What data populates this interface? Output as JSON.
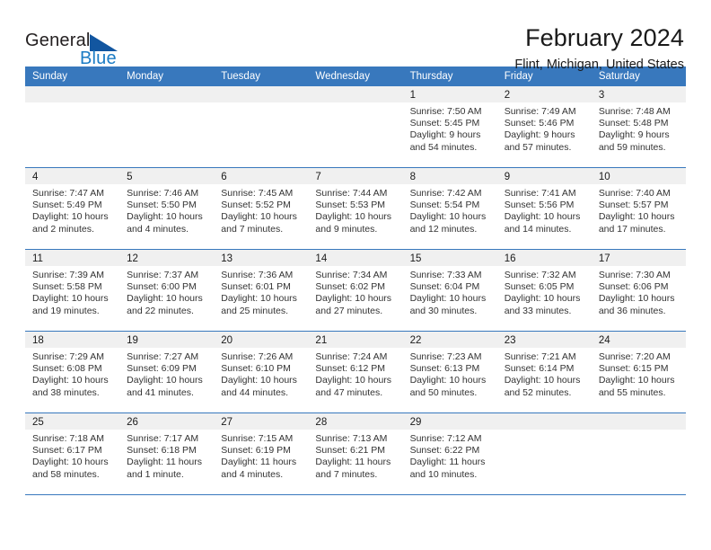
{
  "brand": {
    "word_one": "General",
    "word_two": "Blue",
    "logo_icon": "triangle-logo-icon"
  },
  "header": {
    "title": "February 2024",
    "location": "Flint, Michigan, United States"
  },
  "calendar": {
    "weekday_headers": [
      "Sunday",
      "Monday",
      "Tuesday",
      "Wednesday",
      "Thursday",
      "Friday",
      "Saturday"
    ],
    "accent_color": "#3878bd",
    "daynum_band_color": "#f0f0f0",
    "weeks": [
      [
        {
          "day": "",
          "sunrise": "",
          "sunset": "",
          "daylight": "",
          "empty": true
        },
        {
          "day": "",
          "sunrise": "",
          "sunset": "",
          "daylight": "",
          "empty": true
        },
        {
          "day": "",
          "sunrise": "",
          "sunset": "",
          "daylight": "",
          "empty": true
        },
        {
          "day": "",
          "sunrise": "",
          "sunset": "",
          "daylight": "",
          "empty": true
        },
        {
          "day": "1",
          "sunrise": "Sunrise: 7:50 AM",
          "sunset": "Sunset: 5:45 PM",
          "daylight": "Daylight: 9 hours and 54 minutes."
        },
        {
          "day": "2",
          "sunrise": "Sunrise: 7:49 AM",
          "sunset": "Sunset: 5:46 PM",
          "daylight": "Daylight: 9 hours and 57 minutes."
        },
        {
          "day": "3",
          "sunrise": "Sunrise: 7:48 AM",
          "sunset": "Sunset: 5:48 PM",
          "daylight": "Daylight: 9 hours and 59 minutes."
        }
      ],
      [
        {
          "day": "4",
          "sunrise": "Sunrise: 7:47 AM",
          "sunset": "Sunset: 5:49 PM",
          "daylight": "Daylight: 10 hours and 2 minutes."
        },
        {
          "day": "5",
          "sunrise": "Sunrise: 7:46 AM",
          "sunset": "Sunset: 5:50 PM",
          "daylight": "Daylight: 10 hours and 4 minutes."
        },
        {
          "day": "6",
          "sunrise": "Sunrise: 7:45 AM",
          "sunset": "Sunset: 5:52 PM",
          "daylight": "Daylight: 10 hours and 7 minutes."
        },
        {
          "day": "7",
          "sunrise": "Sunrise: 7:44 AM",
          "sunset": "Sunset: 5:53 PM",
          "daylight": "Daylight: 10 hours and 9 minutes."
        },
        {
          "day": "8",
          "sunrise": "Sunrise: 7:42 AM",
          "sunset": "Sunset: 5:54 PM",
          "daylight": "Daylight: 10 hours and 12 minutes."
        },
        {
          "day": "9",
          "sunrise": "Sunrise: 7:41 AM",
          "sunset": "Sunset: 5:56 PM",
          "daylight": "Daylight: 10 hours and 14 minutes."
        },
        {
          "day": "10",
          "sunrise": "Sunrise: 7:40 AM",
          "sunset": "Sunset: 5:57 PM",
          "daylight": "Daylight: 10 hours and 17 minutes."
        }
      ],
      [
        {
          "day": "11",
          "sunrise": "Sunrise: 7:39 AM",
          "sunset": "Sunset: 5:58 PM",
          "daylight": "Daylight: 10 hours and 19 minutes."
        },
        {
          "day": "12",
          "sunrise": "Sunrise: 7:37 AM",
          "sunset": "Sunset: 6:00 PM",
          "daylight": "Daylight: 10 hours and 22 minutes."
        },
        {
          "day": "13",
          "sunrise": "Sunrise: 7:36 AM",
          "sunset": "Sunset: 6:01 PM",
          "daylight": "Daylight: 10 hours and 25 minutes."
        },
        {
          "day": "14",
          "sunrise": "Sunrise: 7:34 AM",
          "sunset": "Sunset: 6:02 PM",
          "daylight": "Daylight: 10 hours and 27 minutes."
        },
        {
          "day": "15",
          "sunrise": "Sunrise: 7:33 AM",
          "sunset": "Sunset: 6:04 PM",
          "daylight": "Daylight: 10 hours and 30 minutes."
        },
        {
          "day": "16",
          "sunrise": "Sunrise: 7:32 AM",
          "sunset": "Sunset: 6:05 PM",
          "daylight": "Daylight: 10 hours and 33 minutes."
        },
        {
          "day": "17",
          "sunrise": "Sunrise: 7:30 AM",
          "sunset": "Sunset: 6:06 PM",
          "daylight": "Daylight: 10 hours and 36 minutes."
        }
      ],
      [
        {
          "day": "18",
          "sunrise": "Sunrise: 7:29 AM",
          "sunset": "Sunset: 6:08 PM",
          "daylight": "Daylight: 10 hours and 38 minutes."
        },
        {
          "day": "19",
          "sunrise": "Sunrise: 7:27 AM",
          "sunset": "Sunset: 6:09 PM",
          "daylight": "Daylight: 10 hours and 41 minutes."
        },
        {
          "day": "20",
          "sunrise": "Sunrise: 7:26 AM",
          "sunset": "Sunset: 6:10 PM",
          "daylight": "Daylight: 10 hours and 44 minutes."
        },
        {
          "day": "21",
          "sunrise": "Sunrise: 7:24 AM",
          "sunset": "Sunset: 6:12 PM",
          "daylight": "Daylight: 10 hours and 47 minutes."
        },
        {
          "day": "22",
          "sunrise": "Sunrise: 7:23 AM",
          "sunset": "Sunset: 6:13 PM",
          "daylight": "Daylight: 10 hours and 50 minutes."
        },
        {
          "day": "23",
          "sunrise": "Sunrise: 7:21 AM",
          "sunset": "Sunset: 6:14 PM",
          "daylight": "Daylight: 10 hours and 52 minutes."
        },
        {
          "day": "24",
          "sunrise": "Sunrise: 7:20 AM",
          "sunset": "Sunset: 6:15 PM",
          "daylight": "Daylight: 10 hours and 55 minutes."
        }
      ],
      [
        {
          "day": "25",
          "sunrise": "Sunrise: 7:18 AM",
          "sunset": "Sunset: 6:17 PM",
          "daylight": "Daylight: 10 hours and 58 minutes."
        },
        {
          "day": "26",
          "sunrise": "Sunrise: 7:17 AM",
          "sunset": "Sunset: 6:18 PM",
          "daylight": "Daylight: 11 hours and 1 minute."
        },
        {
          "day": "27",
          "sunrise": "Sunrise: 7:15 AM",
          "sunset": "Sunset: 6:19 PM",
          "daylight": "Daylight: 11 hours and 4 minutes."
        },
        {
          "day": "28",
          "sunrise": "Sunrise: 7:13 AM",
          "sunset": "Sunset: 6:21 PM",
          "daylight": "Daylight: 11 hours and 7 minutes."
        },
        {
          "day": "29",
          "sunrise": "Sunrise: 7:12 AM",
          "sunset": "Sunset: 6:22 PM",
          "daylight": "Daylight: 11 hours and 10 minutes."
        },
        {
          "day": "",
          "sunrise": "",
          "sunset": "",
          "daylight": "",
          "empty": true
        },
        {
          "day": "",
          "sunrise": "",
          "sunset": "",
          "daylight": "",
          "empty": true
        }
      ]
    ]
  }
}
